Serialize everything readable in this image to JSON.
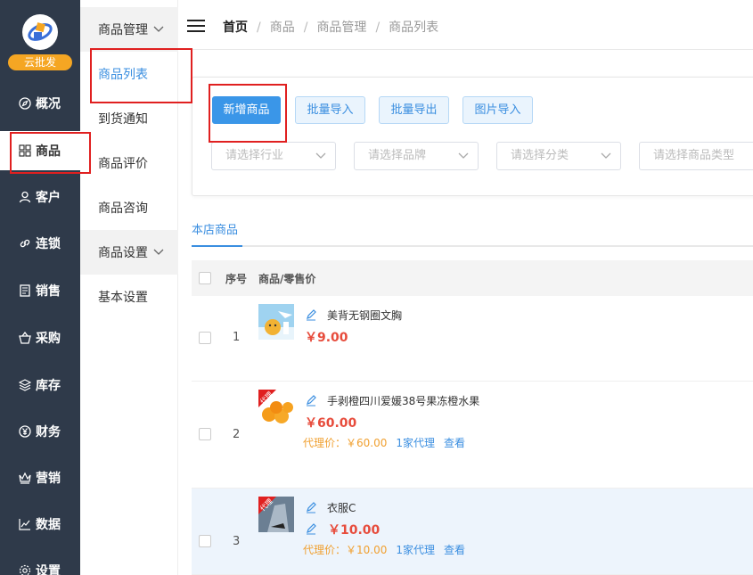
{
  "sidebar": {
    "brand": "云批发",
    "items": [
      {
        "label": "概况",
        "icon": "compass-icon"
      },
      {
        "label": "商品",
        "icon": "grid-icon"
      },
      {
        "label": "客户",
        "icon": "user-icon"
      },
      {
        "label": "连锁",
        "icon": "link-icon"
      },
      {
        "label": "销售",
        "icon": "document-icon"
      },
      {
        "label": "采购",
        "icon": "basket-icon"
      },
      {
        "label": "库存",
        "icon": "layers-icon"
      },
      {
        "label": "财务",
        "icon": "yen-icon"
      },
      {
        "label": "营销",
        "icon": "crown-icon"
      },
      {
        "label": "数据",
        "icon": "line-chart-icon"
      },
      {
        "label": "设置",
        "icon": "gear-icon"
      }
    ]
  },
  "submenu": {
    "group1": "商品管理",
    "items1": [
      "商品列表",
      "到货通知",
      "商品评价",
      "商品咨询"
    ],
    "group2": "商品设置",
    "items2": [
      "基本设置"
    ]
  },
  "breadcrumb": [
    "首页",
    "商品",
    "商品管理",
    "商品列表"
  ],
  "toolbar": {
    "add": "新增商品",
    "import": "批量导入",
    "export": "批量导出",
    "image_import": "图片导入"
  },
  "filters": {
    "industry": "请选择行业",
    "brand": "请选择品牌",
    "category": "请选择分类",
    "type": "请选择商品类型"
  },
  "tab": "本店商品",
  "table": {
    "col_no": "序号",
    "col_goods": "商品/零售价",
    "rows": [
      {
        "no": "1",
        "name": "美背无钢圈文胸",
        "price": "￥9.00"
      },
      {
        "no": "2",
        "name": "手剥橙四川爱媛38号果冻橙水果",
        "price": "￥60.00",
        "agent": "代理价：￥60.00",
        "agent_count": "1家代理",
        "view": "查看",
        "badge": "代理"
      },
      {
        "no": "3",
        "name": "衣服C",
        "price": "￥10.00",
        "agent": "代理价：￥10.00",
        "agent_count": "1家代理",
        "view": "查看",
        "badge": "代理"
      }
    ]
  }
}
